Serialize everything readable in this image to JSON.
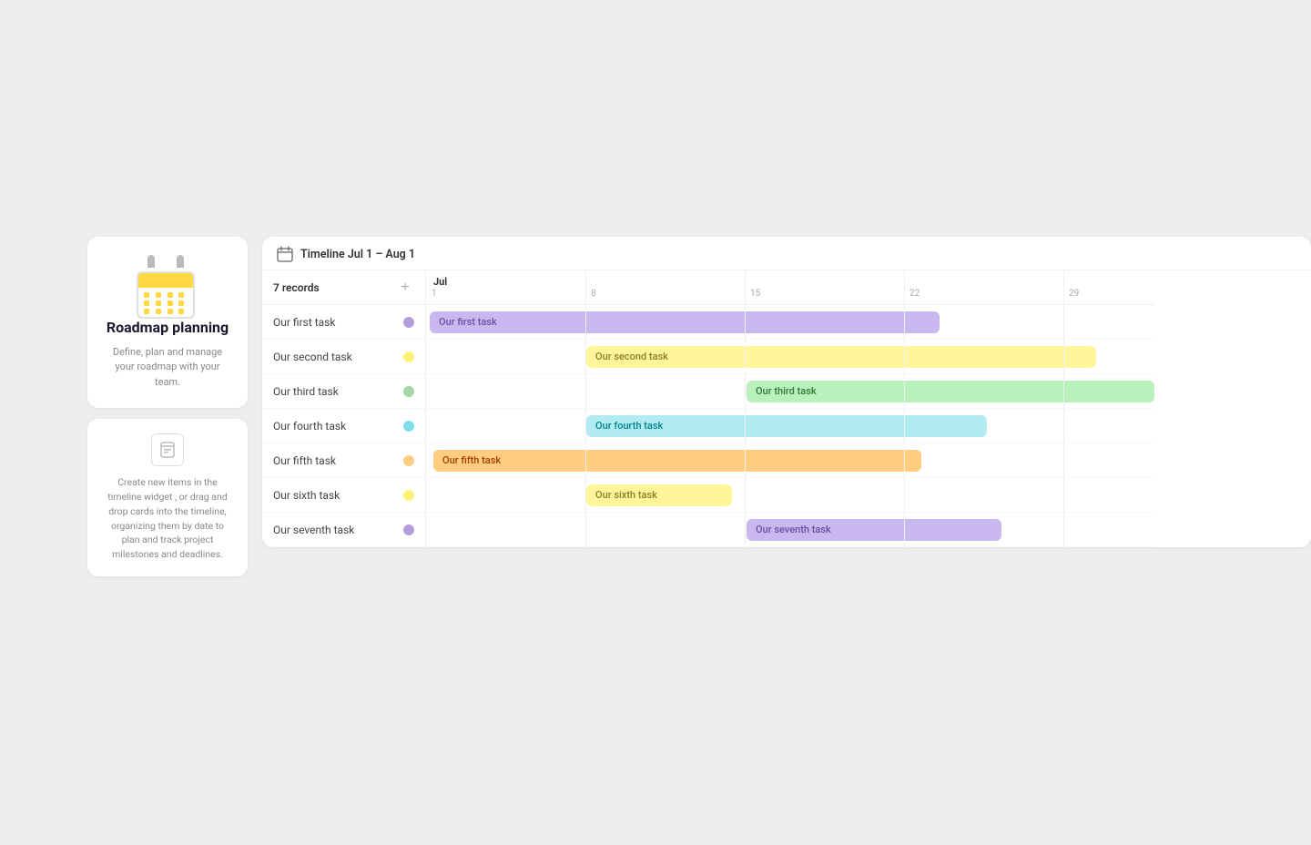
{
  "sidebar": {
    "hero_card": {
      "title": "Roadmap planning",
      "description": "Define, plan and manage your roadmap with your team."
    },
    "info_card": {
      "text": "Create new items in the timeline widget , or drag and drop cards into the timeline, organizing them by date to  plan and track project milestones and deadlines."
    }
  },
  "timeline": {
    "title": "Timeline Jul 1 – Aug 1",
    "records_label": "7 records",
    "add_btn_label": "+",
    "month_label": "Jul",
    "day_markers": [
      {
        "day": "1",
        "offset_pct": 0
      },
      {
        "day": "8",
        "offset_pct": 21.875
      },
      {
        "day": "15",
        "offset_pct": 43.75
      },
      {
        "day": "22",
        "offset_pct": 65.625
      },
      {
        "day": "29",
        "offset_pct": 87.5
      }
    ],
    "tasks": [
      {
        "id": 1,
        "name": "Our first task",
        "dot_color": "#b39ddb",
        "bar_color": "#c9b8f0",
        "bar_text": "Our first task",
        "bar_text_color": "#6a4fa0",
        "bar_left_pct": 0.5,
        "bar_width_pct": 70
      },
      {
        "id": 2,
        "name": "Our second task",
        "dot_color": "#fff176",
        "bar_color": "#fff59d",
        "bar_text": "Our second task",
        "bar_text_color": "#8a8020",
        "bar_left_pct": 22,
        "bar_width_pct": 70
      },
      {
        "id": 3,
        "name": "Our third task",
        "dot_color": "#a5d6a7",
        "bar_color": "#b9f0bb",
        "bar_text": "Our third task",
        "bar_text_color": "#2e7d32",
        "bar_left_pct": 44,
        "bar_width_pct": 56
      },
      {
        "id": 4,
        "name": "Our fourth task",
        "dot_color": "#80deea",
        "bar_color": "#b2ebf2",
        "bar_text": "Our fourth task",
        "bar_text_color": "#00838f",
        "bar_left_pct": 22,
        "bar_width_pct": 55
      },
      {
        "id": 5,
        "name": "Our fifth task",
        "dot_color": "#ffcc80",
        "bar_color": "#ffcc80",
        "bar_text": "Our fifth task",
        "bar_text_color": "#a04000",
        "bar_left_pct": 1,
        "bar_width_pct": 67
      },
      {
        "id": 6,
        "name": "Our sixth task",
        "dot_color": "#fff176",
        "bar_color": "#fff59d",
        "bar_text": "Our sixth task",
        "bar_text_color": "#8a8020",
        "bar_left_pct": 22,
        "bar_width_pct": 20
      },
      {
        "id": 7,
        "name": "Our seventh task",
        "dot_color": "#b39ddb",
        "bar_color": "#c9b8f0",
        "bar_text": "Our seventh task",
        "bar_text_color": "#6a4fa0",
        "bar_left_pct": 44,
        "bar_width_pct": 35
      }
    ]
  }
}
